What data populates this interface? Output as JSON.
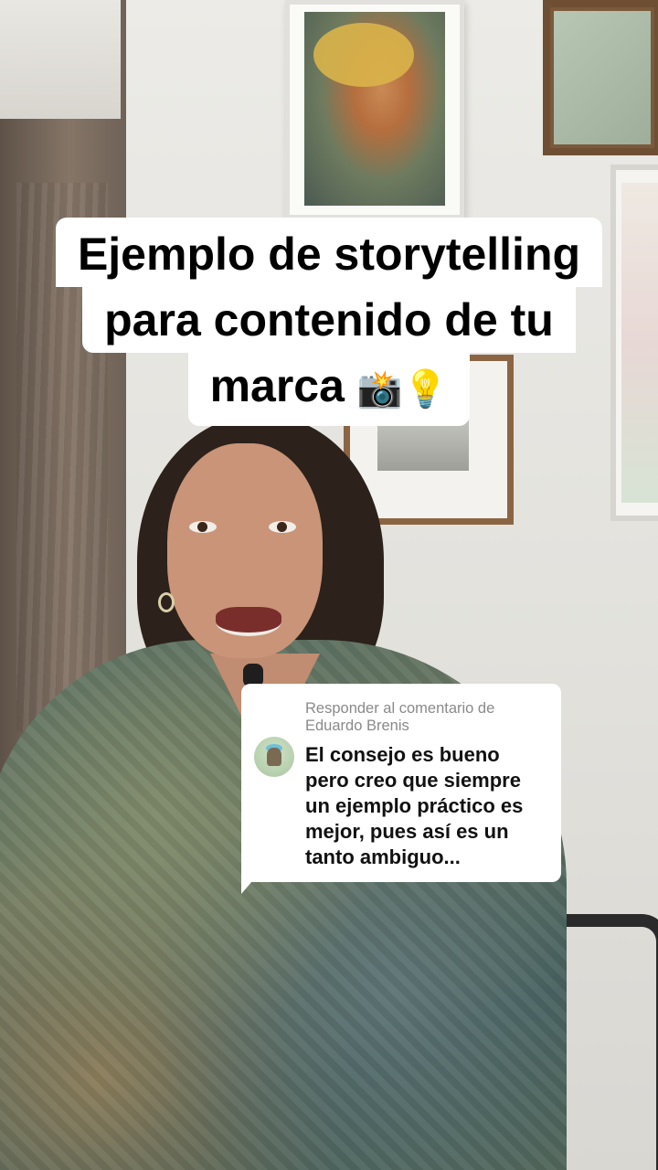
{
  "caption": {
    "line1": "Ejemplo de storytelling",
    "line2": "para contenido de tu",
    "line3_text": "marca ",
    "line3_emojis": "📸💡"
  },
  "reply": {
    "heading": "Responder al comentario de Eduardo Brenis",
    "comment": "El consejo es bueno pero creo que siempre un ejemplo práctico es mejor, pues así es un tanto ambiguo...",
    "avatar_icon": "user-avatar"
  },
  "colors": {
    "caption_bg": "#ffffff",
    "reply_bg": "#ffffff",
    "reply_heading": "#8a8a8a"
  }
}
